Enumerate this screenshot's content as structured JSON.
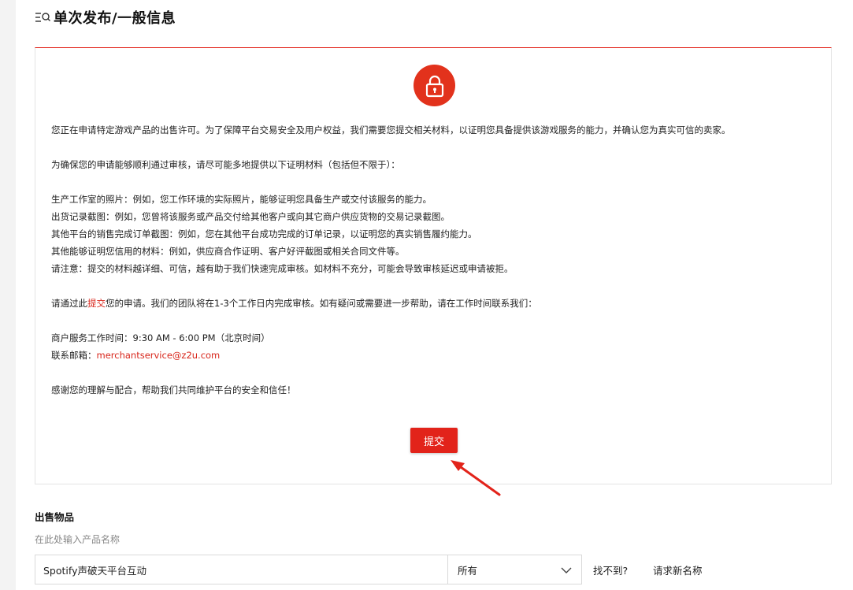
{
  "header": {
    "title": "单次发布/一般信息",
    "menu_icon": "menu-search-icon"
  },
  "notice": {
    "lock_icon": "lock-icon",
    "intro": "您正在申请特定游戏产品的出售许可。为了保障平台交易安全及用户权益，我们需要您提交相关材料，以证明您具备提供该游戏服务的能力，并确认您为真实可信的卖家。",
    "materials_intro": "为确保您的申请能够顺利通过审核，请尽可能多地提供以下证明材料（包括但不限于）：",
    "items": [
      "生产工作室的照片：例如，您工作环境的实际照片，能够证明您具备生产或交付该服务的能力。",
      "出货记录截图：例如，您曾将该服务或产品交付给其他客户或向其它商户供应货物的交易记录截图。",
      "其他平台的销售完成订单截图：例如，您在其他平台成功完成的订单记录，以证明您的真实销售履约能力。",
      "其他能够证明您信用的材料：例如，供应商合作证明、客户好评截图或相关合同文件等。",
      "请注意：提交的材料越详细、可信，越有助于我们快速完成审核。如材料不充分，可能会导致审核延迟或申请被拒。"
    ],
    "submit_line_before": "请通过此",
    "submit_line_link": "提交",
    "submit_line_after": "您的申请。我们的团队将在1-3个工作日内完成审核。如有疑问或需要进一步帮助，请在工作时间联系我们：",
    "hours_label": "商户服务工作时间：",
    "hours_value": "9:30 AM - 6:00 PM（北京时间）",
    "email_label": "联系邮箱：",
    "email_value": "merchantservice@z2u.com",
    "thanks": "感谢您的理解与配合，帮助我们共同维护平台的安全和信任！",
    "submit_button": "提交",
    "accent_color": "#e2231a"
  },
  "sale_item": {
    "section_label": "出售物品",
    "hint": "在此处输入产品名称",
    "product_value": "Spotify声破天平台互动",
    "category_value": "所有",
    "not_found_link": "找不到?",
    "request_link": "请求新名称"
  }
}
